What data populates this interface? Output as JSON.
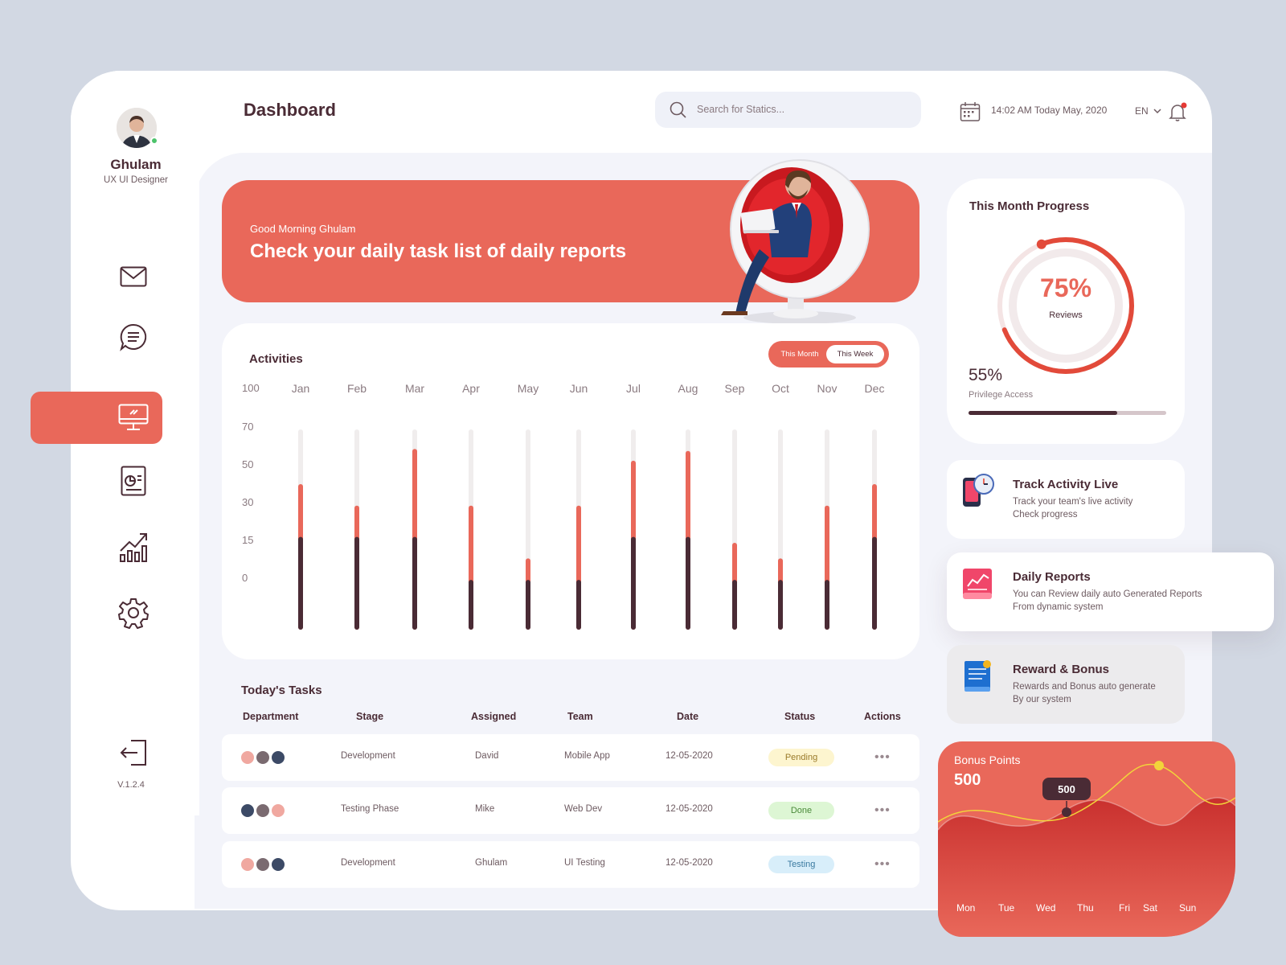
{
  "user": {
    "name": "Ghulam",
    "role": "UX UI Designer"
  },
  "sidebar": {
    "items": [
      {
        "icon": "mail-icon"
      },
      {
        "icon": "chat-icon"
      },
      {
        "icon": "monitor-icon",
        "active": true
      },
      {
        "icon": "report-icon"
      },
      {
        "icon": "analytics-icon"
      },
      {
        "icon": "gear-icon"
      }
    ],
    "logout_icon": "logout-icon",
    "version": "V.1.2.4"
  },
  "header": {
    "title": "Dashboard",
    "search_placeholder": "Search for Statics...",
    "datetime": "14:02 AM Today May, 2020",
    "language": "EN"
  },
  "banner": {
    "greeting": "Good Morning Ghulam",
    "title": "Check your daily task list of daily reports"
  },
  "activities": {
    "title": "Activities",
    "toggle": {
      "left": "This Month",
      "right": "This Week",
      "selected": "This Week"
    }
  },
  "chart_data": {
    "type": "bar",
    "title": "Activities",
    "categories": [
      "Jan",
      "Feb",
      "Mar",
      "Apr",
      "May",
      "Jun",
      "Jul",
      "Aug",
      "Sep",
      "Oct",
      "Nov",
      "Dec"
    ],
    "y_ticks": [
      "100",
      "70",
      "50",
      "30",
      "15",
      "0"
    ],
    "series": [
      {
        "values": [
          45,
          45,
          45,
          23,
          23,
          23,
          45,
          45,
          23,
          23,
          23,
          45
        ]
      },
      {
        "values": [
          72,
          61,
          90,
          61,
          34,
          61,
          84,
          89,
          42,
          34,
          61,
          72
        ]
      }
    ],
    "colors": [
      "#4a2b35",
      "#e9685a"
    ],
    "track_color": "#f0eded"
  },
  "tasks": {
    "title": "Today's Tasks",
    "columns": [
      "Department",
      "Stage",
      "Assigned",
      "Team",
      "Date",
      "Status",
      "Actions"
    ],
    "rows": [
      {
        "stage": "Development",
        "assigned": "David",
        "team": "Mobile App",
        "date": "12-05-2020",
        "status": "Pending"
      },
      {
        "stage": "Testing Phase",
        "assigned": "Mike",
        "team": "Web Dev",
        "date": "12-05-2020",
        "status": "Done"
      },
      {
        "stage": "Development",
        "assigned": "Ghulam",
        "team": "UI Testing",
        "date": "12-05-2020",
        "status": "Testing"
      }
    ],
    "actions_glyph": "•••"
  },
  "progress": {
    "title": "This Month Progress",
    "ring_value": "75%",
    "ring_fraction": 0.75,
    "ring_label": "Reviews",
    "access_value": "55%",
    "access_label": "Privilege Access",
    "bar_fraction": 0.75
  },
  "features": [
    {
      "title": "Track Activity Live",
      "line1": "Track your team's live activity",
      "line2": "Check progress",
      "icon": "clock-phone-icon"
    },
    {
      "title": "Daily Reports",
      "line1": "You can Review daily auto Generated Reports",
      "line2": "From dynamic system",
      "icon": "report-chart-icon"
    },
    {
      "title": "Reward & Bonus",
      "line1": "Rewards and Bonus auto generate",
      "line2": "By our system",
      "icon": "reward-doc-icon"
    }
  ],
  "bonus": {
    "label": "Bonus Points",
    "value": "500",
    "tooltip": "500",
    "days": [
      "Mon",
      "Tue",
      "Wed",
      "Thu",
      "Fri",
      "Sat",
      "Sun"
    ]
  },
  "colors": {
    "accent": "#e9685a",
    "dark": "#4a2b35",
    "background": "#d2d8e3",
    "panel": "#f3f4fa"
  }
}
